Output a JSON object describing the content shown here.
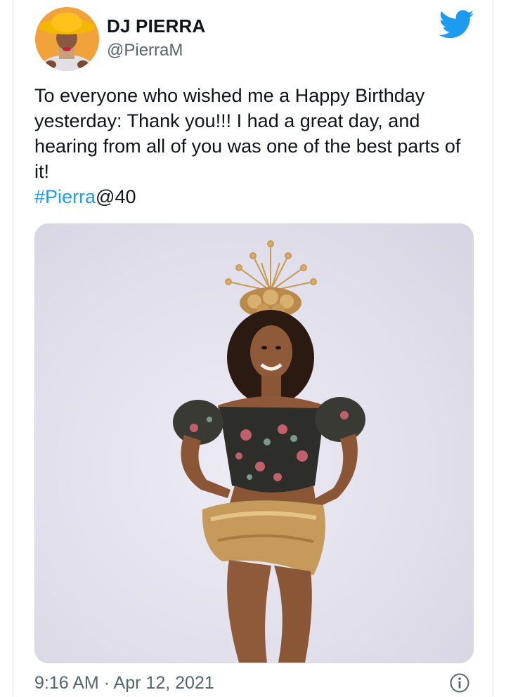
{
  "tweet": {
    "author": {
      "display_name": "DJ PIERRA",
      "handle": "@PierraM"
    },
    "text": "To everyone who wished me a Happy Birthday yesterday: Thank you!!! I had a great day, and hearing from all of you was one of the best parts of it!",
    "hashtag": "#Pierra",
    "hashtag_suffix": "@40",
    "timestamp": "9:16 AM · Apr 12, 2021"
  },
  "icons": {
    "brand": "twitter-bird-icon",
    "info": "info-icon"
  },
  "colors": {
    "brand_blue": "#1d9bf0",
    "text_primary": "#0f1419",
    "text_secondary": "#536471"
  }
}
